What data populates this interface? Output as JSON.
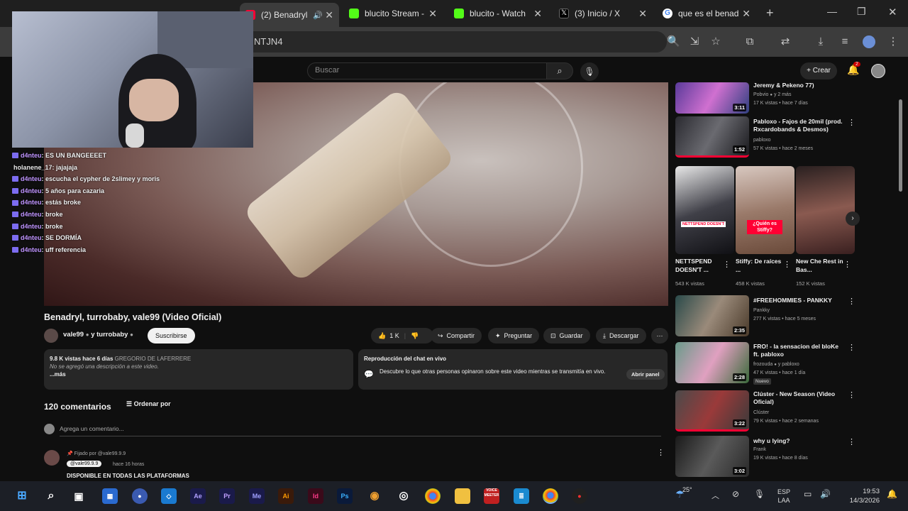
{
  "browser": {
    "tabs": [
      {
        "title": "(2) Benadryl"
      },
      {
        "title": "blucito Stream -"
      },
      {
        "title": "blucito - Watch"
      },
      {
        "title": "(3) Inicio / X"
      },
      {
        "title": "que es el benad"
      }
    ],
    "url_partial": "NTJN4"
  },
  "stream": {
    "chat": [
      {
        "user": "d4nteu",
        "msg": ": ES UN BANGEEEET",
        "twitch": true
      },
      {
        "user": "holanene_17",
        "msg": ": jajajaja",
        "twitch": false
      },
      {
        "user": "d4nteu",
        "msg": ": escucha el cypher de 2slimey y moris",
        "twitch": true
      },
      {
        "user": "d4nteu",
        "msg": ": 5 años para cazaria",
        "twitch": true
      },
      {
        "user": "d4nteu",
        "msg": ": estás broke",
        "twitch": true
      },
      {
        "user": "d4nteu",
        "msg": ": broke",
        "twitch": true
      },
      {
        "user": "d4nteu",
        "msg": ": broke",
        "twitch": true
      },
      {
        "user": "d4nteu",
        "msg": ": SE DORMÍA",
        "twitch": true
      },
      {
        "user": "d4nteu",
        "msg": ": uff referencia",
        "twitch": true
      }
    ]
  },
  "youtube": {
    "search_placeholder": "Buscar",
    "create_label": "Crear",
    "notif_count": "2",
    "video": {
      "title": "Benadryl, turrobaby, vale99 (Video Oficial)",
      "channel": "vale99",
      "channel_extra": "y turrobaby",
      "subscribe": "Suscribirse",
      "likes": "1 K",
      "share": "Compartir",
      "ask": "Preguntar",
      "save": "Guardar",
      "download": "Descargar",
      "stats": "9.8 K vistas  hace 6 días",
      "location": "GREGORIO DE LAFERRERE",
      "no_desc": "No se agregó una descripción a este video.",
      "more": "...más",
      "replay_title": "Reproducción del chat en vivo",
      "replay_text": "Descubre lo que otras personas opinaron sobre este video mientras se transmitía en vivo.",
      "open_panel": "Abrir panel"
    },
    "comments": {
      "count": "120 comentarios",
      "sort": "Ordenar por",
      "add_placeholder": "Agrega un comentario...",
      "pinned_by": "Fijado por @vale99.9.9",
      "first_author": "@vale99.9.9",
      "first_time": "hace 16 horas",
      "first_text": "DISPONIBLE EN TODAS LAS PLATAFORMAS"
    },
    "sidebar": [
      {
        "title": "Jeremy & Pekeno 77)",
        "channel": "Pobvio",
        "meta": "y 2 más",
        "stats": "17 K vistas • hace 7 días",
        "dur": "3:11"
      },
      {
        "title": "Pabloxo - Fajos de 20mil (prod. Rxcardobands & Desmos)",
        "channel": "pabloxo",
        "stats": "57 K vistas • hace 2 meses",
        "dur": "1:52"
      },
      {
        "title": "#FREEHOMMIES - PANKKY",
        "channel": "Pankky",
        "stats": "277 K vistas • hace 5 meses",
        "dur": "2:35"
      },
      {
        "title": "FRO! - la sensacion del bloKe ft. pabloxo",
        "channel": "frozouda",
        "meta": "y pabloxo",
        "stats": "47 K vistas • hace 1 día",
        "badge": "Nuevo",
        "dur": "2:28"
      },
      {
        "title": "Clúster - New Season (Video Oficial)",
        "channel": "Clúster",
        "stats": "79 K vistas • hace 2 semanas",
        "dur": "3:22"
      },
      {
        "title": "why u lying?",
        "channel": "Frank",
        "stats": "19 K vistas • hace 8 días",
        "dur": "3:02"
      }
    ],
    "shorts": [
      {
        "title": "NETTSPEND DOESN'T ...",
        "views": "543 K vistas",
        "overlay": "NETTSPEND DOESN'T"
      },
      {
        "title": "Stiffy: De raíces ...",
        "views": "458 K vistas",
        "overlay": "¿Quién es Stiffy?"
      },
      {
        "title": "New Che Rest in Bas...",
        "views": "152 K vistas",
        "overlay": ""
      }
    ]
  },
  "taskbar": {
    "temp": "25°",
    "lang1": "ESP",
    "lang2": "LAA",
    "time": "19:53",
    "date": "14/3/2026"
  }
}
